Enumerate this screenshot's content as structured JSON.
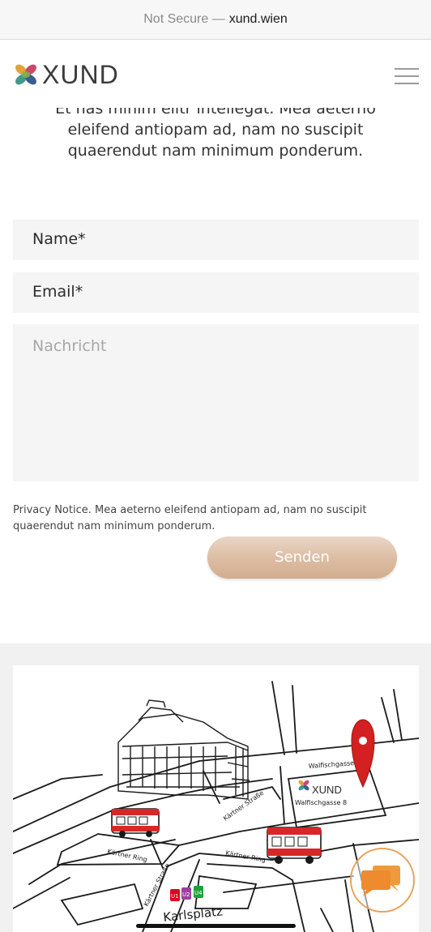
{
  "browser": {
    "security": "Not Secure —",
    "domain": "xund.wien"
  },
  "header": {
    "brand": "XUND",
    "menu_icon": "hamburger-menu-icon"
  },
  "intro": {
    "text": "Et has minim elitr intellegat. Mea aeterno eleifend antiopam ad, nam no suscipit quaerendut nam minimum ponderum."
  },
  "form": {
    "name_label": "Name*",
    "email_label": "Email*",
    "message_placeholder": "Nachricht",
    "privacy": "Privacy Notice. Mea aeterno eleifend antiopam ad, nam no suscipit quaerendut nam minimum ponderum.",
    "submit_label": "Senden"
  },
  "map": {
    "street_walfisch": "Walfischgasse",
    "brand": "XUND",
    "address": "Walfischgasse 8",
    "street_kaertner_strasse": "Kärtner Straße",
    "street_kaertner_ring": "Kärtner Ring",
    "street_kaertner_ring_2": "Kärtner Ring",
    "street_kaertner_strasse_2": "Kärtner Straße",
    "ubahn_lines": [
      "U1",
      "U2",
      "U4"
    ],
    "station": "Karlsplatz",
    "pin_color": "#d42020"
  },
  "colors": {
    "accent": "#d9b699",
    "chat_ring": "#e8a25a"
  },
  "chat": {
    "icon": "chat-bubbles-icon"
  }
}
